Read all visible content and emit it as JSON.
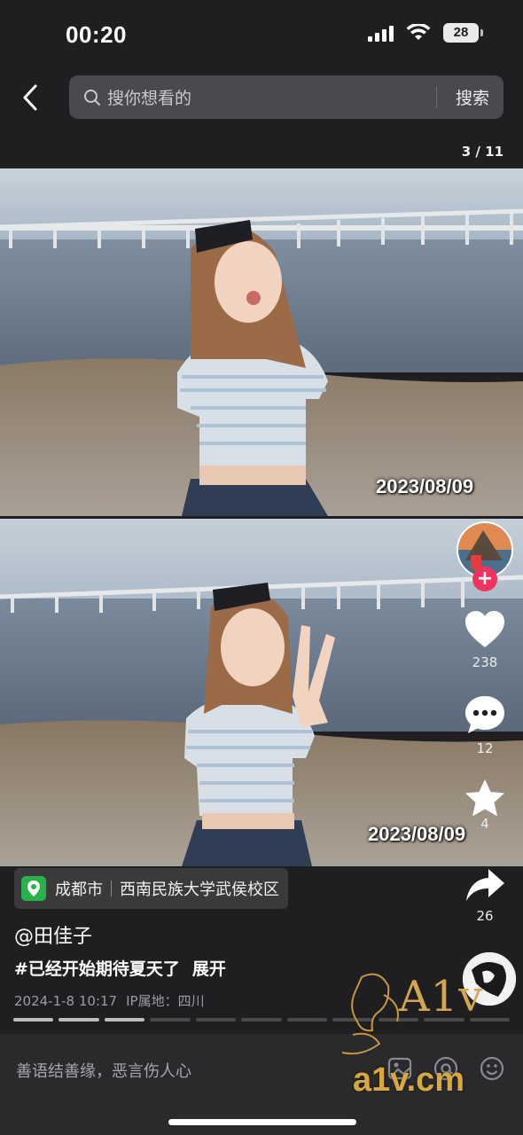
{
  "status_bar": {
    "time": "00:20",
    "battery": "28"
  },
  "search": {
    "placeholder": "搜你想看的",
    "button_label": "搜索"
  },
  "gallery": {
    "page_counter": "3 / 11",
    "total": 11,
    "current": 3
  },
  "photos": [
    {
      "date_stamp": "2023/08/09"
    },
    {
      "date_stamp": "2023/08/09"
    }
  ],
  "actions": {
    "likes": "238",
    "comments": "12",
    "favorites": "4",
    "shares": "26"
  },
  "location": {
    "city": "成都市",
    "place": "西南民族大学武侯校区"
  },
  "post": {
    "author": "@田佳子",
    "caption": "#已经开始期待夏天了",
    "expand_label": "展开",
    "date": "2024-1-8 10:17",
    "ip_location": "IP属地：四川"
  },
  "comment_bar": {
    "placeholder": "善语结善缘，恶言伤人心"
  },
  "watermark": {
    "brand": "A1v",
    "url": "a1v.cm"
  },
  "colors": {
    "background": "#1f1f21",
    "like_red": "#f0335e",
    "location_green": "#27b24b",
    "watermark_gold": "#d4a652"
  }
}
